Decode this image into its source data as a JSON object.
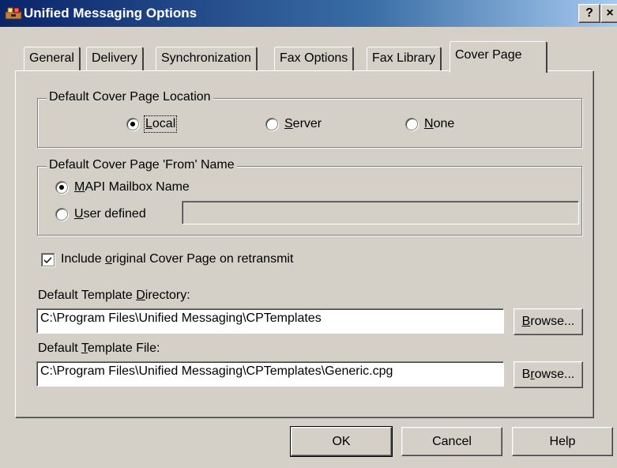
{
  "window": {
    "title": "Unified Messaging Options",
    "help_button": "?",
    "close_button": "×"
  },
  "tabs": [
    {
      "label": "General"
    },
    {
      "label": "Delivery"
    },
    {
      "label": "Synchronization"
    },
    {
      "label": "Fax Options"
    },
    {
      "label": "Fax Library"
    },
    {
      "label": "Cover Page",
      "active": true
    }
  ],
  "location_group": {
    "label": "Default Cover Page Location",
    "options": [
      {
        "pre": "",
        "mn": "L",
        "post": "ocal",
        "selected": true
      },
      {
        "pre": "",
        "mn": "S",
        "post": "erver",
        "selected": false
      },
      {
        "pre": "",
        "mn": "N",
        "post": "one",
        "selected": false
      }
    ]
  },
  "from_group": {
    "label": "Default Cover Page 'From' Name",
    "mapi": {
      "pre": "",
      "mn": "M",
      "post": "API Mailbox Name",
      "selected": true
    },
    "user": {
      "pre": "",
      "mn": "U",
      "post": "ser defined",
      "selected": false
    },
    "user_value": ""
  },
  "include_checkbox": {
    "pre": "Include ",
    "mn": "o",
    "post": "riginal Cover Page on retransmit",
    "checked": true
  },
  "template_dir": {
    "label_pre": "Default Template ",
    "label_mn": "D",
    "label_post": "irectory:",
    "value": "C:\\Program Files\\Unified Messaging\\CPTemplates",
    "browse_mn": "B",
    "browse_post": "rowse..."
  },
  "template_file": {
    "label_pre": "Default ",
    "label_mn": "T",
    "label_post": "emplate File:",
    "value": "C:\\Program Files\\Unified Messaging\\CPTemplates\\Generic.cpg",
    "browse_pre": "B",
    "browse_mn": "r",
    "browse_post": "owse..."
  },
  "buttons": {
    "ok": "OK",
    "cancel": "Cancel",
    "help": "Help"
  }
}
